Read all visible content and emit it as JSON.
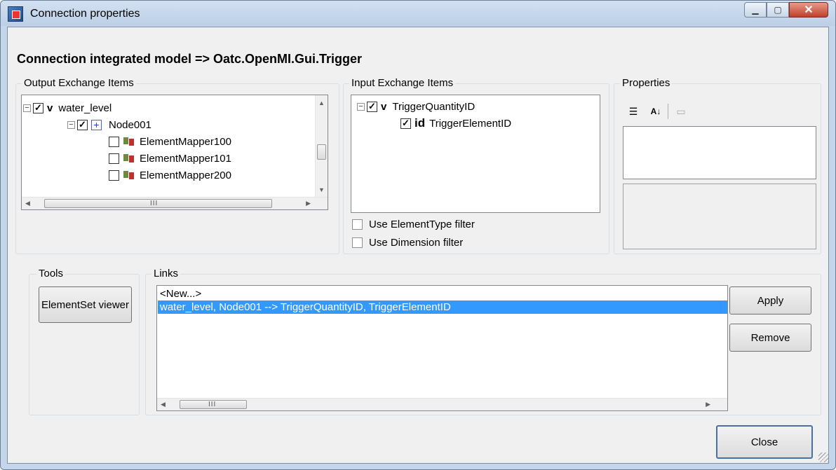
{
  "window": {
    "title": "Connection properties",
    "heading": "Connection integrated model => Oatc.OpenMI.Gui.Trigger"
  },
  "output_items": {
    "title": "Output Exchange Items",
    "tree": [
      {
        "expander": "−",
        "checked": "✓",
        "tag": "v",
        "label": "water_level"
      },
      {
        "expander": "−",
        "checked": "✓",
        "tag": "+",
        "label": "Node001"
      },
      {
        "checked": "",
        "label": "ElementMapper100"
      },
      {
        "checked": "",
        "label": "ElementMapper101"
      },
      {
        "checked": "",
        "label": "ElementMapper200"
      }
    ],
    "hscroll_grip": "III"
  },
  "input_items": {
    "title": "Input Exchange Items",
    "tree": [
      {
        "expander": "−",
        "checked": "✓",
        "tag": "v",
        "label": "TriggerQuantityID"
      },
      {
        "checked": "✓",
        "tag": "id",
        "label": "TriggerElementID"
      }
    ],
    "filter_elementtype": "Use ElementType filter",
    "filter_dimension": "Use Dimension filter"
  },
  "properties": {
    "title": "Properties",
    "icons": [
      "categorized-icon",
      "alphabetical-sort-icon",
      "property-pages-icon"
    ]
  },
  "tools": {
    "title": "Tools",
    "elementset_viewer": "ElementSet viewer"
  },
  "links": {
    "title": "Links",
    "items": [
      {
        "label": "<New...>",
        "selected": false
      },
      {
        "label": "water_level, Node001 --> TriggerQuantityID, TriggerElementID",
        "selected": true
      }
    ],
    "hscroll_grip": "III",
    "apply": "Apply",
    "remove": "Remove"
  },
  "footer": {
    "close": "Close"
  },
  "colors": {
    "selection": "#3399ff",
    "window_frame": "#c5d6ea",
    "client_bg": "#f0f0f0"
  }
}
